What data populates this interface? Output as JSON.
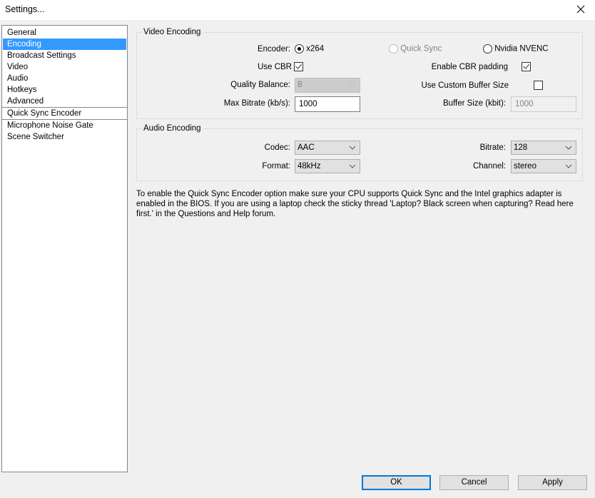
{
  "window": {
    "title": "Settings...",
    "close_icon": "close-icon"
  },
  "sidebar": {
    "items": [
      {
        "label": "General",
        "selected": false
      },
      {
        "label": "Encoding",
        "selected": true
      },
      {
        "label": "Broadcast Settings",
        "selected": false
      },
      {
        "label": "Video",
        "selected": false
      },
      {
        "label": "Audio",
        "selected": false
      },
      {
        "label": "Hotkeys",
        "selected": false
      },
      {
        "label": "Advanced",
        "selected": false
      },
      {
        "label": "Quick Sync Encoder",
        "selected": false
      },
      {
        "label": "Microphone Noise Gate",
        "selected": false
      },
      {
        "label": "Scene Switcher",
        "selected": false
      }
    ]
  },
  "video_encoding": {
    "title": "Video Encoding",
    "encoder_label": "Encoder:",
    "encoder_options": [
      {
        "label": "x264",
        "checked": true,
        "enabled": true
      },
      {
        "label": "Quick Sync",
        "checked": false,
        "enabled": false
      },
      {
        "label": "Nvidia NVENC",
        "checked": false,
        "enabled": true
      }
    ],
    "use_cbr_label": "Use CBR",
    "use_cbr_checked": true,
    "enable_cbr_padding_label": "Enable CBR padding",
    "enable_cbr_padding_checked": true,
    "quality_balance_label": "Quality Balance:",
    "quality_balance_value": "8",
    "use_custom_buffer_label": "Use Custom Buffer Size",
    "use_custom_buffer_checked": false,
    "max_bitrate_label": "Max Bitrate (kb/s):",
    "max_bitrate_value": "1000",
    "buffer_size_label": "Buffer Size (kbit):",
    "buffer_size_value": "1000"
  },
  "audio_encoding": {
    "title": "Audio Encoding",
    "codec_label": "Codec:",
    "codec_value": "AAC",
    "bitrate_label": "Bitrate:",
    "bitrate_value": "128",
    "format_label": "Format:",
    "format_value": "48kHz",
    "channel_label": "Channel:",
    "channel_value": "stereo"
  },
  "note": "To enable the Quick Sync Encoder option make sure your CPU supports Quick Sync and the Intel graphics adapter is enabled in the BIOS. If you are using a laptop check the sticky thread 'Laptop? Black screen when capturing? Read here first.' in the Questions and Help forum.",
  "buttons": {
    "ok": "OK",
    "cancel": "Cancel",
    "apply": "Apply"
  }
}
